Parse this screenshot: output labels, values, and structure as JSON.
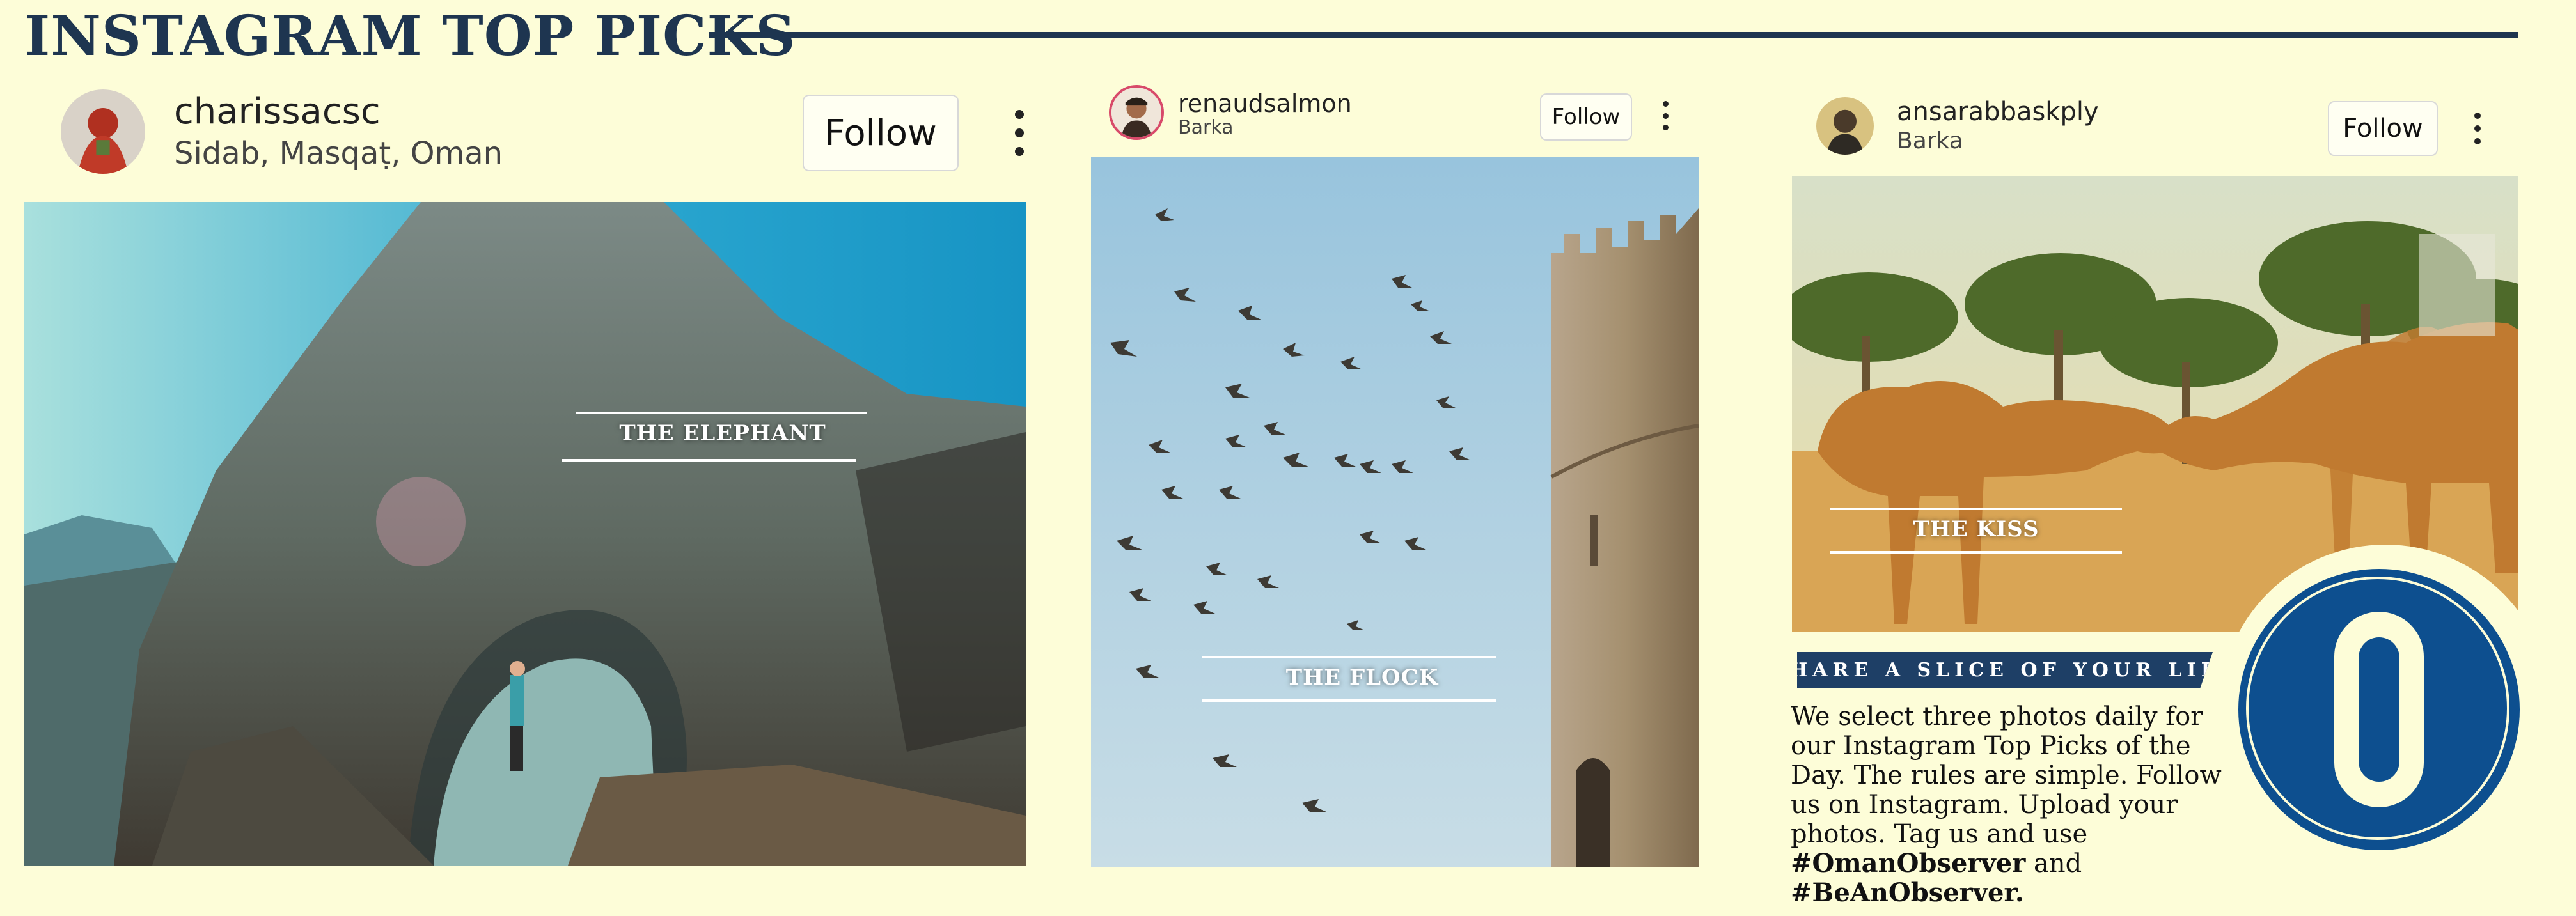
{
  "header": {
    "title": "INSTAGRAM TOP PICKS"
  },
  "posts": [
    {
      "username": "charissacsc",
      "location": "Sidab, Masqaṭ, Oman",
      "follow_label": "Follow",
      "caption": "THE ELEPHANT",
      "icon": "more-vert-icon"
    },
    {
      "username": "renaudsalmon",
      "location": "Barka",
      "follow_label": "Follow",
      "caption": "THE FLOCK",
      "icon": "more-vert-icon"
    },
    {
      "username": "ansarabbaskply",
      "location": "Barka",
      "follow_label": "Follow",
      "caption": "THE KISS",
      "icon": "more-vert-icon"
    }
  ],
  "info": {
    "banner": "SHARE A SLICE OF YOUR LIFE",
    "text": "We select three photos daily for our Instagram Top Picks of the Day. The rules are simple. Follow us on Instagram. Upload your photos. Tag us and use",
    "hashtag1": "#OmanObserver",
    "connector": "and",
    "hashtag2": "#BeAnObserver."
  },
  "logo": {
    "letter": "O",
    "color": "#0d4f8f"
  },
  "colors": {
    "background": "#fdfdd8",
    "title": "#1e3550"
  }
}
